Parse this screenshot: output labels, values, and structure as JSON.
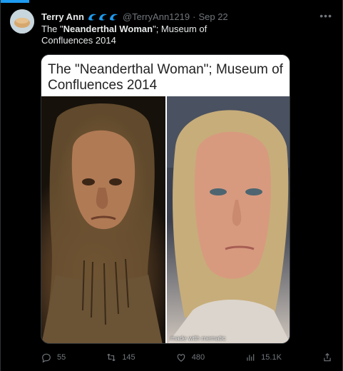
{
  "tweet": {
    "author_name": "Terry Ann",
    "handle": "@TerryAnn1219",
    "separator": "·",
    "date": "Sep 22",
    "text_pre": "The \"",
    "text_bold": "Neanderthal Woman",
    "text_post": "\"; Museum of Confluences 2014"
  },
  "card": {
    "title": "The \"Neanderthal Woman\"; Museum of Confluences 2014",
    "watermark": "made with mematic"
  },
  "actions": {
    "replies": "55",
    "retweets": "145",
    "likes": "480",
    "views": "15.1K"
  },
  "icons": {
    "badges": [
      "wave-icon",
      "wave-icon",
      "wave-icon"
    ],
    "more": "more-icon",
    "reply": "reply-icon",
    "retweet": "retweet-icon",
    "like": "heart-icon",
    "views": "bar-chart-icon",
    "share": "share-icon"
  },
  "colors": {
    "accent": "#1d9bf0",
    "muted": "#71767b",
    "text": "#e7e9ea"
  }
}
